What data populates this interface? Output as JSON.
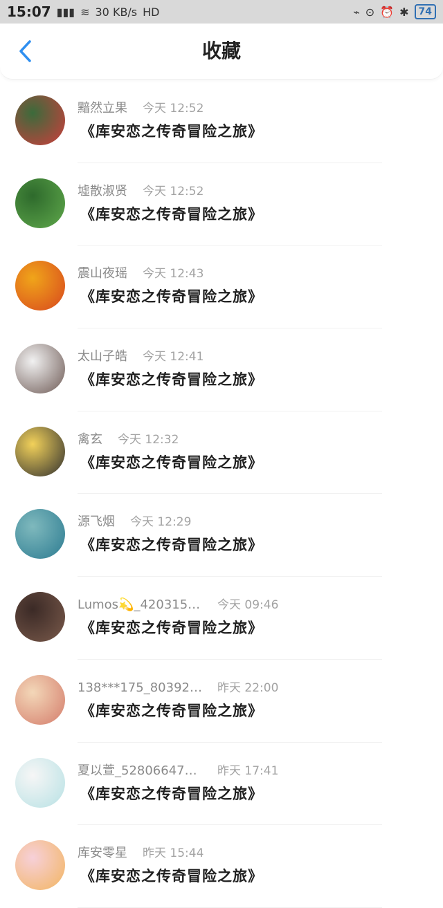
{
  "status_bar": {
    "time": "15:07",
    "signal_label": "4G",
    "speed": "30 KB/s",
    "hd_label": "HD",
    "battery": "74"
  },
  "header": {
    "title": "收藏"
  },
  "colors": {
    "accent": "#2f8ff0",
    "divider": "#f1f1f1"
  },
  "items": [
    {
      "name": "黯然立果",
      "time": "今天 12:52",
      "title": "《库安恋之传奇冒险之旅》",
      "avatar": {
        "bg1": "#3b6b3b",
        "bg2": "#cf3d3d"
      }
    },
    {
      "name": "墟散淑贤",
      "time": "今天 12:52",
      "title": "《库安恋之传奇冒险之旅》",
      "avatar": {
        "bg1": "#2e6a2c",
        "bg2": "#5fa84b"
      }
    },
    {
      "name": "震山夜瑶",
      "time": "今天 12:43",
      "title": "《库安恋之传奇冒险之旅》",
      "avatar": {
        "bg1": "#f0a51a",
        "bg2": "#d8471e"
      }
    },
    {
      "name": "太山子皓",
      "time": "今天 12:41",
      "title": "《库安恋之传奇冒险之旅》",
      "avatar": {
        "bg1": "#f1f1f1",
        "bg2": "#6e5a55"
      }
    },
    {
      "name": "禽玄",
      "time": "今天 12:32",
      "title": "《库安恋之传奇冒险之旅》",
      "avatar": {
        "bg1": "#f2d15a",
        "bg2": "#2f2f2f"
      }
    },
    {
      "name": "源飞烟",
      "time": "今天 12:29",
      "title": "《库安恋之传奇冒险之旅》",
      "avatar": {
        "bg1": "#7fb9bd",
        "bg2": "#2c7b91"
      }
    },
    {
      "name": "Lumos💫_42031502…",
      "time": "今天 09:46",
      "title": "《库安恋之传奇冒险之旅》",
      "avatar": {
        "bg1": "#3b2a26",
        "bg2": "#7a5a4b"
      }
    },
    {
      "name": "138***175_803921…",
      "time": "昨天 22:00",
      "title": "《库安恋之传奇冒险之旅》",
      "avatar": {
        "bg1": "#f3d7b8",
        "bg2": "#d47c6b"
      }
    },
    {
      "name": "夏以萱_528066471…",
      "time": "昨天 17:41",
      "title": "《库安恋之传奇冒险之旅》",
      "avatar": {
        "bg1": "#f6f6f6",
        "bg2": "#b7e1e4"
      }
    },
    {
      "name": "库安零星",
      "time": "昨天 15:44",
      "title": "《库安恋之传奇冒险之旅》",
      "avatar": {
        "bg1": "#f7d0d9",
        "bg2": "#f2b560"
      }
    }
  ]
}
